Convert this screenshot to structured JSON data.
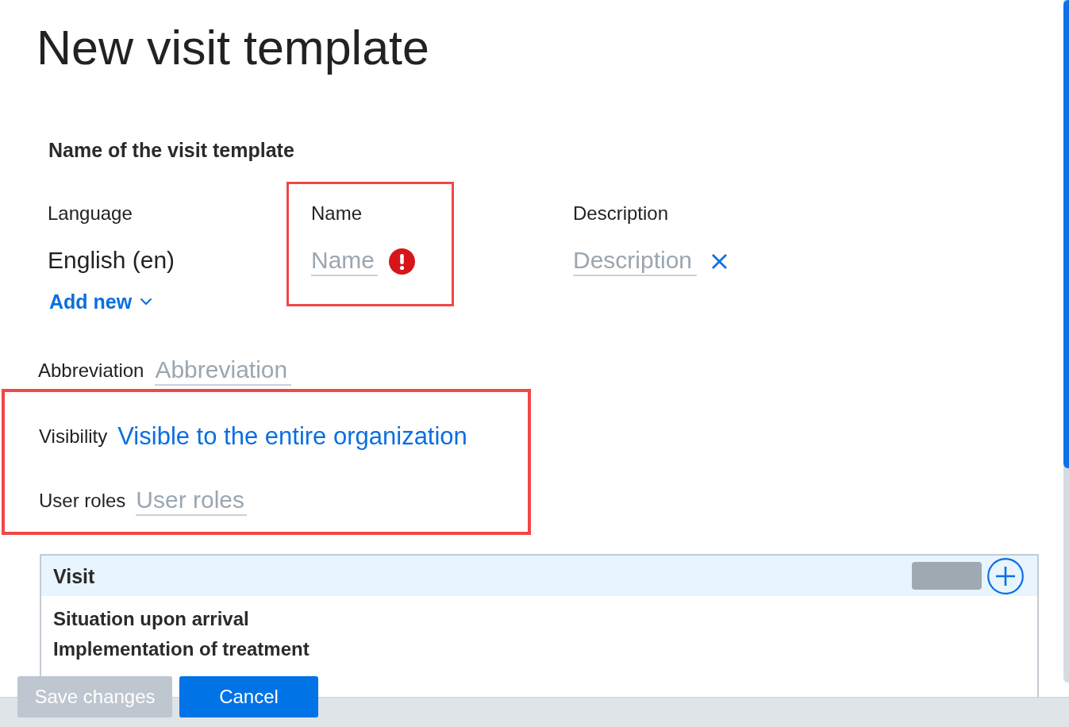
{
  "page": {
    "title": "New visit template"
  },
  "name_section": {
    "heading": "Name of the visit template",
    "language": {
      "label": "Language",
      "value": "English (en)",
      "add_new": "Add new"
    },
    "name": {
      "label": "Name",
      "placeholder": "Name",
      "error": true,
      "highlighted": true
    },
    "description": {
      "label": "Description",
      "placeholder": "Description",
      "clearable": true
    }
  },
  "abbreviation": {
    "label": "Abbreviation",
    "placeholder": "Abbreviation"
  },
  "access": {
    "highlighted": true,
    "visibility": {
      "label": "Visibility",
      "value": "Visible to the entire organization"
    },
    "user_roles": {
      "label": "User roles",
      "placeholder": "User roles"
    }
  },
  "visit_panel": {
    "title": "Visit",
    "items": [
      "Situation upon arrival",
      "Implementation of treatment"
    ]
  },
  "footer": {
    "buttons": [
      {
        "label": "Save changes",
        "disabled": true
      },
      {
        "label": "Cancel",
        "disabled": false
      }
    ]
  }
}
